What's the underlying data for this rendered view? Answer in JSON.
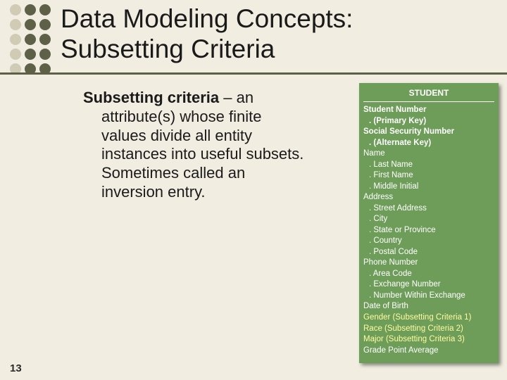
{
  "title_line1": "Data Modeling Concepts:",
  "title_line2": "Subsetting Criteria",
  "body": {
    "term": "Subsetting criteria",
    "dash": " – an",
    "rest1": "attribute(s) whose finite",
    "rest2": "values divide all entity",
    "rest3": "instances into useful subsets.",
    "rest4": "Sometimes called an",
    "rest5": "inversion entry."
  },
  "entity": {
    "title": "STUDENT",
    "rows": [
      {
        "text": "Student Number",
        "bold": true
      },
      {
        "text": "(Primary Key)",
        "bold": true,
        "sub": true
      },
      {
        "text": "Social Security Number",
        "bold": true
      },
      {
        "text": "(Alternate Key)",
        "bold": true,
        "sub": true
      },
      {
        "text": "Name"
      },
      {
        "text": "Last Name",
        "sub": true
      },
      {
        "text": "First Name",
        "sub": true
      },
      {
        "text": "Middle Initial",
        "sub": true
      },
      {
        "text": "Address"
      },
      {
        "text": "Street Address",
        "sub": true
      },
      {
        "text": "City",
        "sub": true
      },
      {
        "text": "State or Province",
        "sub": true
      },
      {
        "text": "Country",
        "sub": true
      },
      {
        "text": "Postal Code",
        "sub": true
      },
      {
        "text": "Phone Number"
      },
      {
        "text": "Area Code",
        "sub": true
      },
      {
        "text": "Exchange Number",
        "sub": true
      },
      {
        "text": "Number Within Exchange",
        "sub": true
      },
      {
        "text": "Date of Birth"
      },
      {
        "text": "Gender (Subsetting Criteria 1)",
        "yellow": true
      },
      {
        "text": "Race (Subsetting Criteria 2)",
        "yellow": true
      },
      {
        "text": "Major (Subsetting Criteria 3)",
        "yellow": true
      },
      {
        "text": "Grade Point Average"
      }
    ]
  },
  "dots": {
    "cols": [
      22,
      43,
      64
    ],
    "rows": [
      14,
      35,
      56,
      77,
      98
    ],
    "dark": "#5e6047",
    "light": "#cfcbb4"
  },
  "page_number": "13"
}
